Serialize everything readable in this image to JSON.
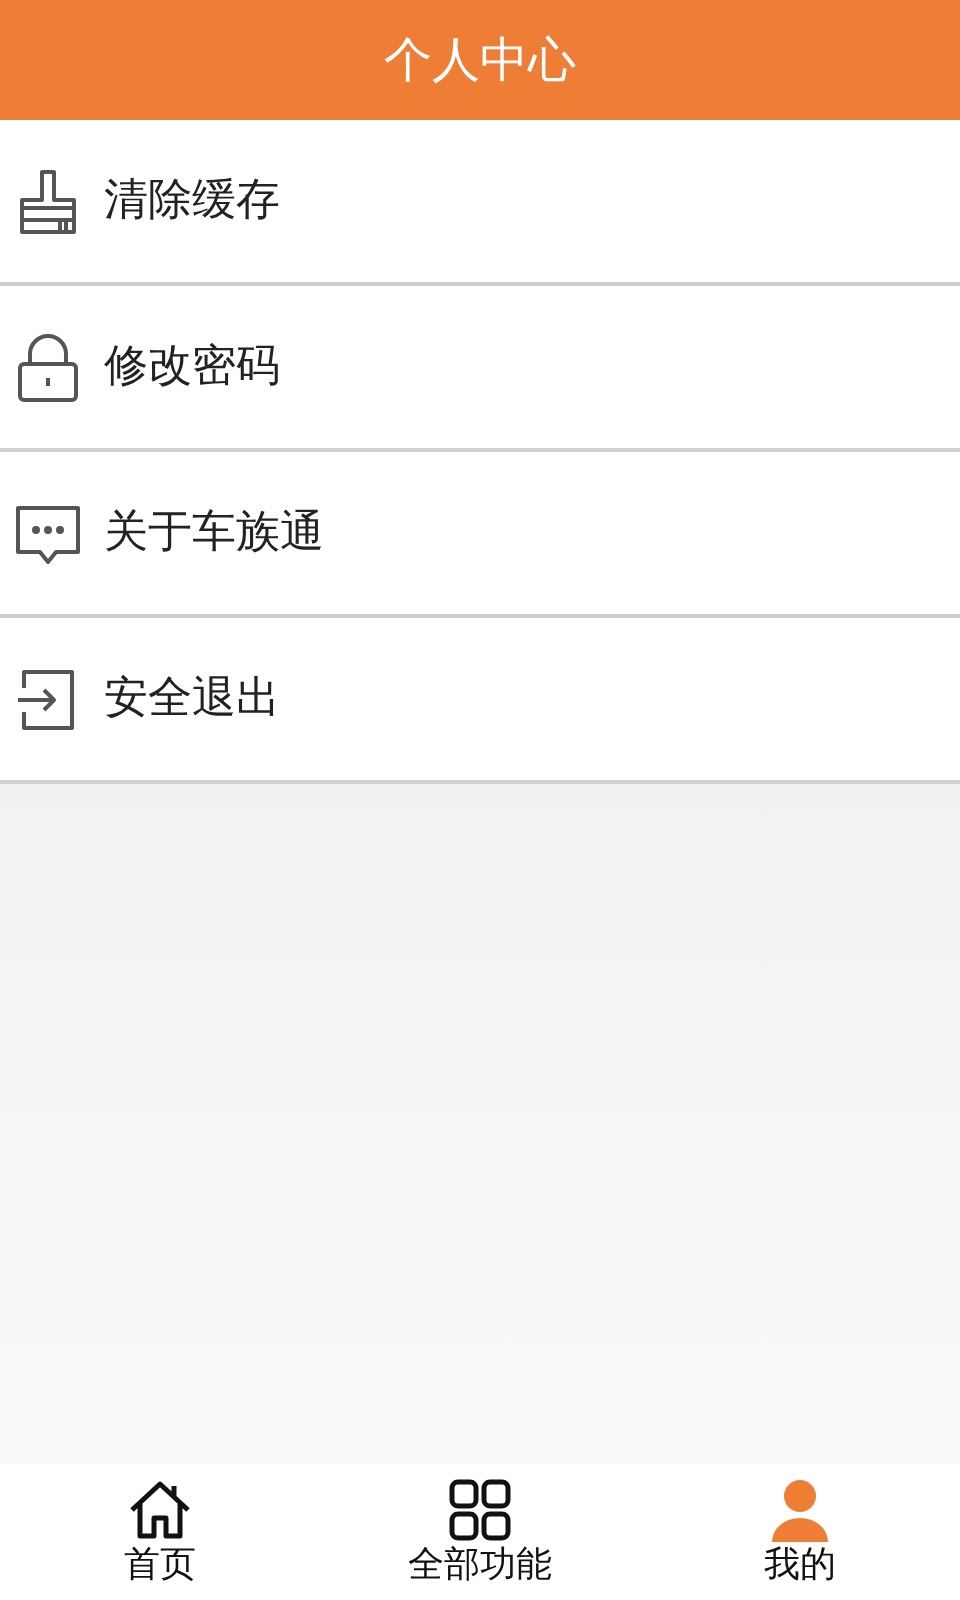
{
  "header": {
    "title": "个人中心"
  },
  "menu": [
    {
      "kind": "brush",
      "label": "清除缓存"
    },
    {
      "kind": "lock",
      "label": "修改密码"
    },
    {
      "kind": "chat",
      "label": "关于车族通"
    },
    {
      "kind": "exit",
      "label": "安全退出"
    }
  ],
  "tab_bar": [
    {
      "kind": "home",
      "label": "首页",
      "selected": false
    },
    {
      "kind": "grid",
      "label": "全部功能",
      "selected": false
    },
    {
      "kind": "person",
      "label": "我的",
      "selected": true
    }
  ]
}
